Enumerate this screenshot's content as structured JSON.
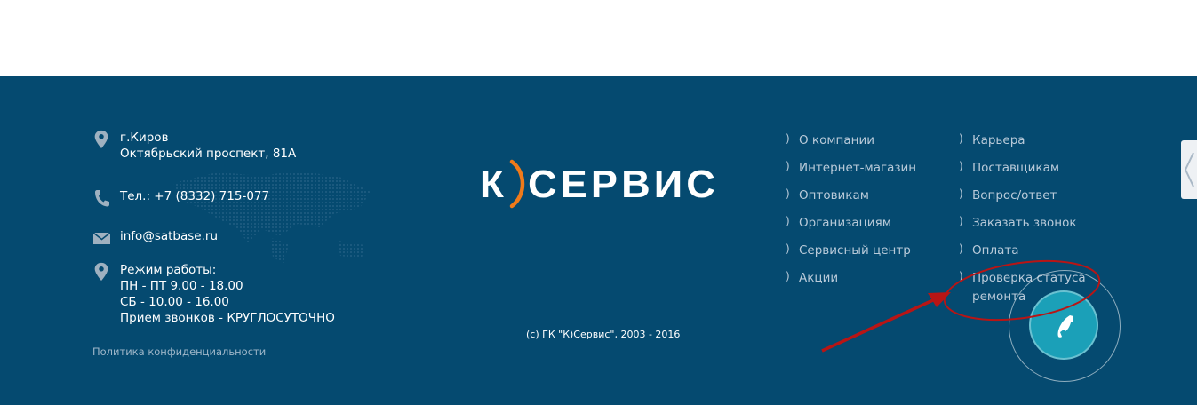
{
  "contacts": {
    "city": "г.Киров",
    "street": "Октябрьский проспект, 81А",
    "phone": "Тел.: +7 (8332) 715-077",
    "email": "info@satbase.ru",
    "hours_title": "Режим работы:",
    "hours_weekday": "ПН - ПТ 9.00 - 18.00",
    "hours_saturday": "СБ - 10.00 - 16.00",
    "hours_calls": "Прием звонков - КРУГЛОСУТОЧНО"
  },
  "privacy_link": "Политика конфиденциальности",
  "logo": {
    "left_part": "К",
    "right_part": "СЕРВИС"
  },
  "copyright": "(c) ГК \"К)Сервис\", 2003 - 2016",
  "nav": {
    "bullet": ")",
    "col1": [
      "О компании",
      "Интернет-магазин",
      "Оптовикам",
      "Организациям",
      "Сервисный центр",
      "Акции"
    ],
    "col2": [
      "Карьера",
      "Поставщикам",
      "Вопрос/ответ",
      "Заказать звонок",
      "Оплата",
      "Проверка статуса ремонта"
    ]
  },
  "icons": {
    "location": "location-pin-icon",
    "phone": "phone-icon",
    "email": "envelope-icon",
    "call_button": "phone-handset-icon",
    "side_tab": "chevron-left-icon"
  },
  "colors": {
    "footer_bg": "#054a70",
    "accent_orange": "#f07a1a",
    "call_button": "#1ba0b8",
    "annotation_red": "#b81515"
  }
}
